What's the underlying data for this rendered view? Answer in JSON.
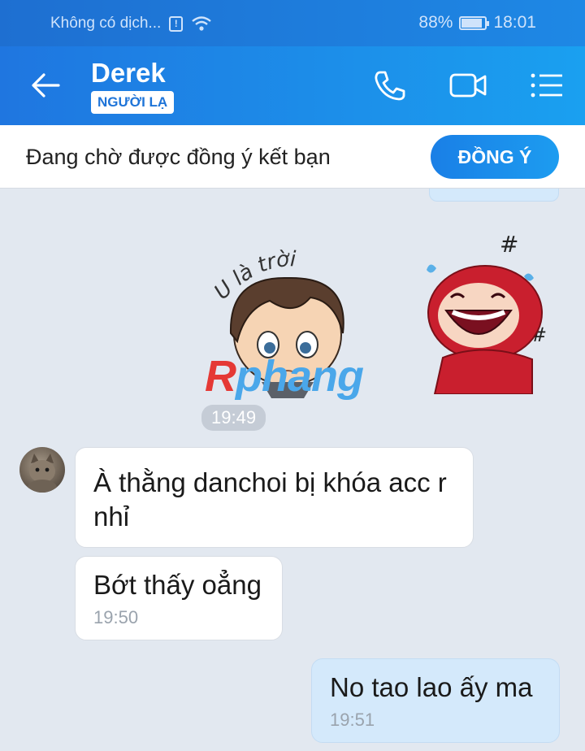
{
  "status_bar": {
    "carrier": "Không có dịch...",
    "battery": "88%",
    "battery_level": 0.88,
    "time": "18:01"
  },
  "header": {
    "name": "Derek",
    "badge": "NGƯỜI LẠ",
    "icons": [
      "back-arrow-icon",
      "phone-icon",
      "video-camera-icon",
      "menu-list-icon"
    ]
  },
  "friend_request": {
    "text": "Đang chờ được đồng ý kết bạn",
    "accept_label": "ĐỒNG Ý"
  },
  "chat": {
    "sticker_caption": "U là trời",
    "sticker_time": "19:49",
    "watermark": {
      "first": "R",
      "rest": "phang"
    },
    "messages": [
      {
        "side": "left",
        "text": "À thằng danchoi bị khóa acc r nhỉ",
        "time": ""
      },
      {
        "side": "left",
        "text": "Bớt thấy oẳng",
        "time": "19:50"
      },
      {
        "side": "right",
        "text": "No tao lao ấy ma",
        "time": "19:51"
      }
    ]
  },
  "colors": {
    "header_start": "#1f76e0",
    "header_end": "#1aa0f0",
    "chat_background": "#e2e8f0",
    "sent_bubble": "#d4e9fb",
    "received_bubble": "#ffffff",
    "accent": "#1a7fe6"
  }
}
